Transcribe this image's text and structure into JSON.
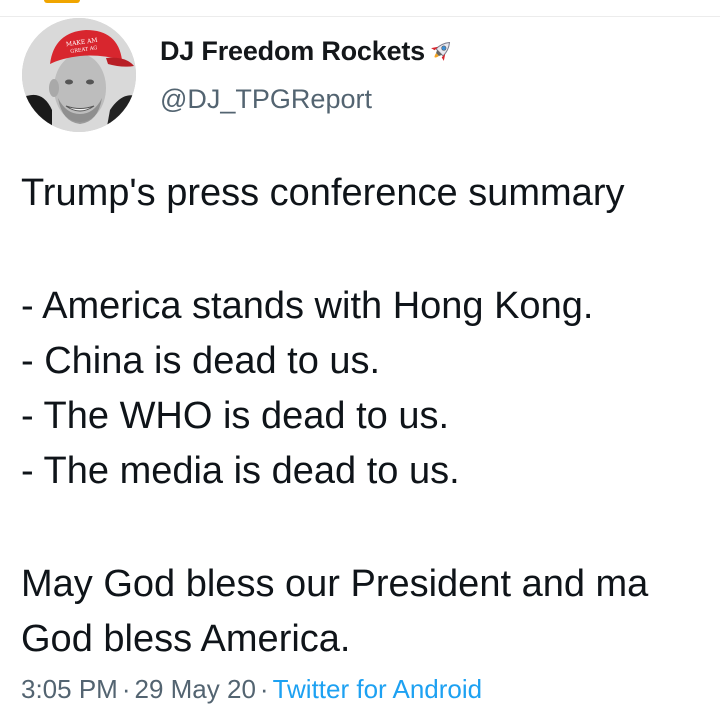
{
  "user": {
    "display_name": "DJ Freedom Rockets",
    "handle": "@DJ_TPGReport",
    "name_emoji_icon": "rocket-icon",
    "avatar_hat_text": "MAKE AMERICA GREAT AGAIN"
  },
  "tweet": {
    "lines": [
      "Trump's press conference summary",
      "- America stands with Hong Kong.",
      "- China is dead to us.",
      "- The WHO is dead to us.",
      "- The media is dead to us.",
      "May God bless our President and ma",
      "God bless America."
    ]
  },
  "meta": {
    "time": "3:05 PM",
    "separator": "·",
    "date": "29 May 20",
    "source": "Twitter for Android"
  },
  "colors": {
    "text": "#0f1419",
    "secondary": "#536471",
    "link": "#1da1f2",
    "hat_red": "#d8262e"
  }
}
